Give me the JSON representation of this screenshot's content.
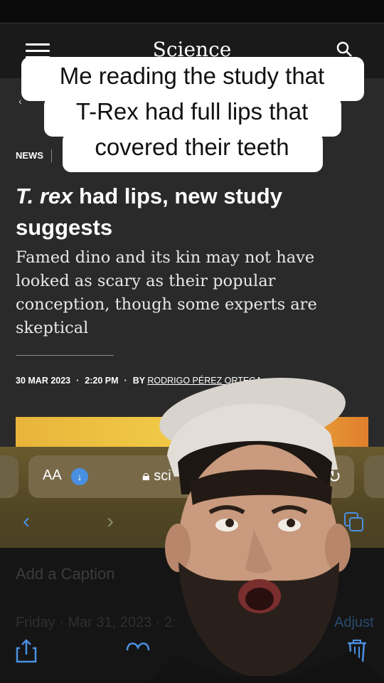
{
  "site": {
    "logo": "Science",
    "back_label": "‹"
  },
  "article": {
    "section": "NEWS",
    "headline_italic": "T. rex",
    "headline_rest": " had lips, new study suggests",
    "dek": "Famed dino and its kin may not have looked as scary as their popular conception, though some experts are skeptical",
    "date": "30 MAR 2023",
    "time": "2:20 PM",
    "by_label": "BY",
    "author": "RODRIGO PÉREZ ORTEGA"
  },
  "overlay_caption": {
    "lines": [
      "Me reading the study that",
      "T-Rex had full lips that",
      "covered their teeth"
    ]
  },
  "browser": {
    "aa_label": "AA",
    "url": "sci",
    "reload_icon": "reload-icon"
  },
  "photos": {
    "add_caption": "Add a Caption",
    "date": "Friday · Mar 31, 2023 · 2:",
    "adjust": "Adjust"
  },
  "colors": {
    "accent": "#4a90e2",
    "nav_bg": "#1a1a1a",
    "article_bg": "#2a2a2a"
  }
}
